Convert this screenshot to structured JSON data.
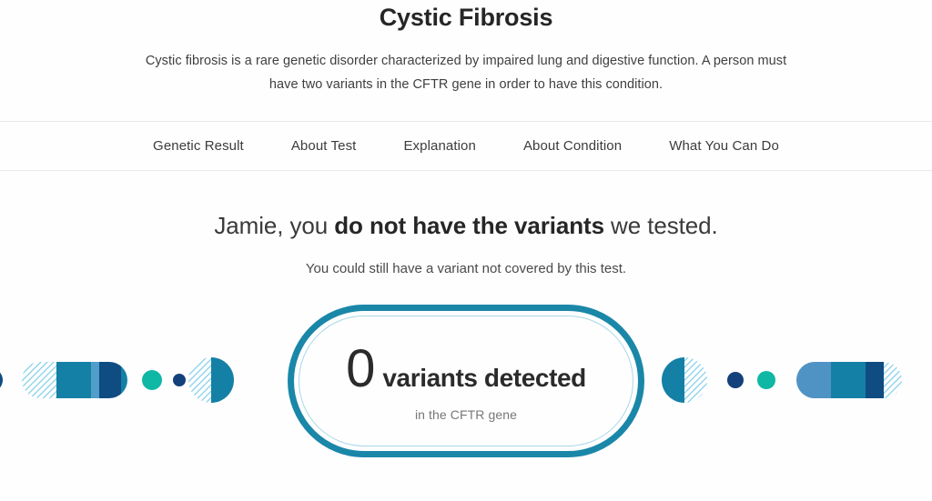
{
  "header": {
    "title": "Cystic Fibrosis",
    "description": "Cystic fibrosis is a rare genetic disorder characterized by impaired lung and digestive function. A person must have two variants in the CFTR gene in order to have this condition."
  },
  "nav": {
    "items": [
      {
        "label": "Genetic Result"
      },
      {
        "label": "About Test"
      },
      {
        "label": "Explanation"
      },
      {
        "label": "About Condition"
      },
      {
        "label": "What You Can Do"
      }
    ]
  },
  "result": {
    "greeting_prefix": "Jamie, you ",
    "emphasis": "do not have the variants",
    "greeting_suffix": " we tested.",
    "note": "You could still have a variant not covered by this test."
  },
  "badge": {
    "count": "0",
    "label": "variants detected",
    "subtext": "in the CFTR gene"
  },
  "colors": {
    "accent_teal": "#1a87a8",
    "inner_ring": "#a8d8ea",
    "deep_navy": "#0f4c81",
    "mid_blue": "#1580a5",
    "steel_blue": "#4f93c4",
    "light_blue": "#5bb0d8",
    "green_teal": "#0fb8a4",
    "hatch_blue": "#7fcde8",
    "divider": "#e9e9e9",
    "background": "#fefefe"
  },
  "decor": {
    "left": {
      "name": "chromosome-illustration-left",
      "elements": [
        "edge-dot-navy",
        "capsule-hatched-left",
        "dot-green-teal",
        "dot-navy-small",
        "half-circle-hatched-left"
      ]
    },
    "right": {
      "name": "chromosome-illustration-right",
      "elements": [
        "half-circle-hatched-right",
        "dot-navy-small",
        "dot-green-teal",
        "capsule-hatched-right"
      ]
    }
  }
}
